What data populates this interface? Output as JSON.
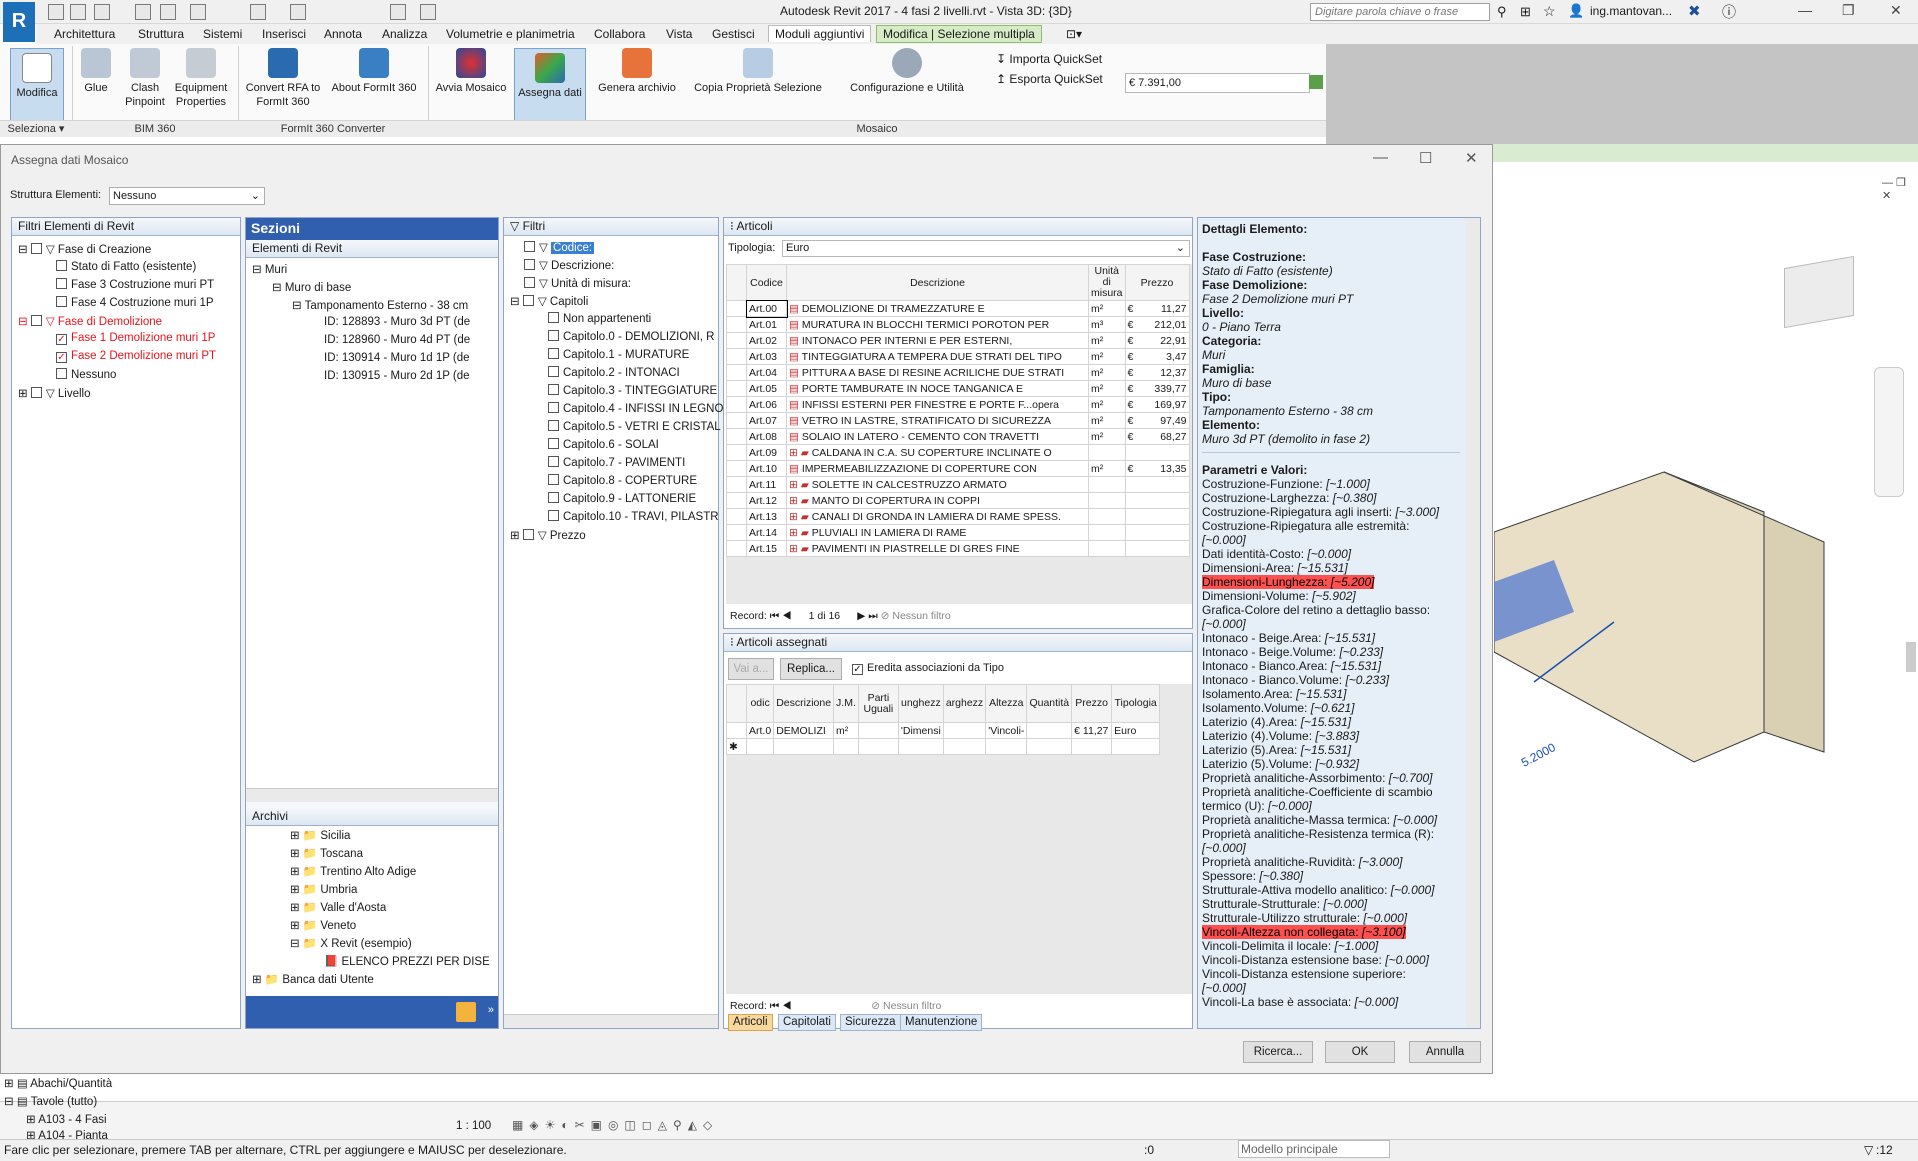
{
  "app": {
    "logo": "R",
    "title": "Autodesk Revit 2017 -    4 fasi 2 livelli.rvt - Vista 3D: {3D}",
    "search_placeholder": "Digitare parola chiave o frase",
    "user": "ing.mantovan..."
  },
  "tabs": [
    "Architettura",
    "Struttura",
    "Sistemi",
    "Inserisci",
    "Annota",
    "Analizza",
    "Volumetrie e planimetria",
    "Collabora",
    "Vista",
    "Gestisci",
    "Moduli aggiuntivi",
    "Modifica | Selezione multipla"
  ],
  "ribbon": {
    "buttons": [
      "Modifica",
      "Glue",
      "Clash Pinpoint",
      "Equipment Properties",
      "Convert RFA to FormIt 360",
      "About FormIt 360",
      "Avvia Mosaico",
      "Assegna dati",
      "Genera archivio",
      "Copia Proprietà Selezione",
      "Configurazione e Utilità",
      "Importa QuickSet",
      "Esporta QuickSet"
    ],
    "panels": [
      "Seleziona",
      "BIM 360",
      "FormIt 360 Converter",
      "Mosaico"
    ],
    "price": "€ 7.391,00"
  },
  "dialog": {
    "title": "Assegna dati Mosaico",
    "struttura_label": "Struttura Elementi:",
    "struttura_value": "Nessuno",
    "filtri_revit": {
      "header": "Filtri Elementi di Revit",
      "items": [
        "Fase di Creazione",
        "Stato di Fatto (esistente)",
        "Fase 3 Costruzione muri PT",
        "Fase 4 Costruzione muri 1P",
        "Fase di Demolizione",
        "Fase 1 Demolizione muri 1P",
        "Fase 2 Demolizione muri PT",
        "Nessuno",
        "Livello"
      ]
    },
    "sezioni": {
      "header": "Sezioni",
      "subheader": "Elementi di Revit",
      "items": [
        "Muri",
        "Muro di base",
        "Tamponamento Esterno - 38 cm",
        "ID: 128893 - Muro 3d PT (de",
        "ID: 128960 - Muro 4d PT (de",
        "ID: 130914 - Muro 1d 1P (de",
        "ID: 130915 - Muro 2d 1P (de"
      ]
    },
    "archivi": {
      "header": "Archivi",
      "items": [
        "Sicilia",
        "Toscana",
        "Trentino Alto Adige",
        "Umbria",
        "Valle d'Aosta",
        "Veneto",
        "X Revit (esempio)",
        "ELENCO PREZZI PER DISE",
        "Banca dati Utente"
      ]
    },
    "filtri": {
      "header": "Filtri",
      "items": [
        "Codice:",
        "Descrizione:",
        "Unità di misura:",
        "Capitoli",
        "Non appartenenti",
        "Capitolo.0 - DEMOLIZIONI, R",
        "Capitolo.1 - MURATURE",
        "Capitolo.2 - INTONACI",
        "Capitolo.3 - TINTEGGIATURE",
        "Capitolo.4 - INFISSI IN LEGNO",
        "Capitolo.5 - VETRI E CRISTAL",
        "Capitolo.6 - SOLAI",
        "Capitolo.7 - PAVIMENTI",
        "Capitolo.8 - COPERTURE",
        "Capitolo.9 - LATTONERIE",
        "Capitolo.10 - TRAVI, PILASTR",
        "Prezzo"
      ]
    },
    "articoli": {
      "header": "Articoli",
      "tipologia_label": "Tipologia:",
      "tipologia_value": "Euro",
      "columns": [
        "Codice",
        "Descrizione",
        "Unità di misura",
        "Prezzo"
      ],
      "rows": [
        {
          "code": "Art.00",
          "desc": "DEMOLIZIONE DI TRAMEZZATURE E",
          "unit": "m²",
          "cur": "€",
          "price": "11,27"
        },
        {
          "code": "Art.01",
          "desc": "MURATURA IN BLOCCHI TERMICI POROTON PER",
          "unit": "m³",
          "cur": "€",
          "price": "212,01"
        },
        {
          "code": "Art.02",
          "desc": "INTONACO PER INTERNI E PER ESTERNI,",
          "unit": "m²",
          "cur": "€",
          "price": "22,91"
        },
        {
          "code": "Art.03",
          "desc": "TINTEGGIATURA A TEMPERA DUE STRATI DEL TIPO",
          "unit": "m²",
          "cur": "€",
          "price": "3,47"
        },
        {
          "code": "Art.04",
          "desc": "PITTURA A BASE DI RESINE ACRILICHE DUE STRATI",
          "unit": "m²",
          "cur": "€",
          "price": "12,37"
        },
        {
          "code": "Art.05",
          "desc": "PORTE TAMBURATE IN NOCE TANGANICA E",
          "unit": "m²",
          "cur": "€",
          "price": "339,77"
        },
        {
          "code": "Art.06",
          "desc": "INFISSI ESTERNI PER FINESTRE E PORTE F...opera",
          "unit": "m²",
          "cur": "€",
          "price": "169,97"
        },
        {
          "code": "Art.07",
          "desc": "VETRO IN LASTRE, STRATIFICATO DI SICUREZZA",
          "unit": "m²",
          "cur": "€",
          "price": "97,49"
        },
        {
          "code": "Art.08",
          "desc": "SOLAIO IN LATERO - CEMENTO CON TRAVETTI",
          "unit": "m²",
          "cur": "€",
          "price": "68,27"
        },
        {
          "code": "Art.09",
          "desc": "CALDANA IN C.A. SU COPERTURE INCLINATE O",
          "unit": "",
          "cur": "",
          "price": ""
        },
        {
          "code": "Art.10",
          "desc": "IMPERMEABILIZZAZIONE DI COPERTURE CON",
          "unit": "m²",
          "cur": "€",
          "price": "13,35"
        },
        {
          "code": "Art.11",
          "desc": "SOLETTE IN CALCESTRUZZO ARMATO",
          "unit": "",
          "cur": "",
          "price": ""
        },
        {
          "code": "Art.12",
          "desc": "MANTO DI COPERTURA IN COPPI",
          "unit": "",
          "cur": "",
          "price": ""
        },
        {
          "code": "Art.13",
          "desc": "CANALI DI GRONDA IN LAMIERA DI RAME SPESS.",
          "unit": "",
          "cur": "",
          "price": ""
        },
        {
          "code": "Art.14",
          "desc": "PLUVIALI IN LAMIERA DI RAME",
          "unit": "",
          "cur": "",
          "price": ""
        },
        {
          "code": "Art.15",
          "desc": "PAVIMENTI IN PIASTRELLE DI GRES FINE",
          "unit": "",
          "cur": "",
          "price": ""
        }
      ],
      "record_label": "Record:",
      "record_value": "1 di 16",
      "no_filter": "Nessun filtro"
    },
    "assegnati": {
      "header": "Articoli assegnati",
      "vai": "Vai a...",
      "replica": "Replica...",
      "eredita": "Eredita associazioni da Tipo",
      "columns": [
        "odic",
        "Descrizione",
        "J.M.",
        "Parti Uguali",
        "unghezz",
        "arghezz",
        "Altezza",
        "Quantità",
        "Prezzo",
        "Tipologia"
      ],
      "row": [
        "Art.0",
        "DEMOLIZI",
        "m²",
        "",
        "'Dimensi",
        "",
        "'Vincoli-",
        "",
        "€   11,27",
        "Euro"
      ],
      "record_label": "Record:",
      "no_filter": "Nessun filtro"
    },
    "bottom_tabs": [
      "Articoli",
      "Capitolati",
      "Sicurezza",
      "Manutenzione"
    ],
    "details": {
      "header": "Dettagli Elemento:",
      "props": [
        {
          "k": "Fase Costruzione:",
          "v": "Stato di Fatto (esistente)"
        },
        {
          "k": "Fase Demolizione:",
          "v": "Fase 2 Demolizione muri PT"
        },
        {
          "k": "Livello:",
          "v": "0 - Piano Terra"
        },
        {
          "k": "Categoria:",
          "v": "Muri"
        },
        {
          "k": "Famiglia:",
          "v": "Muro di base"
        },
        {
          "k": "Tipo:",
          "v": "Tamponamento Esterno - 38 cm"
        },
        {
          "k": "Elemento:",
          "v": "Muro 3d PT (demolito in fase 2)"
        }
      ],
      "params_title": "Parametri e Valori:",
      "params": [
        {
          "k": "Costruzione-Funzione:",
          "v": "[~1.000]"
        },
        {
          "k": "Costruzione-Larghezza:",
          "v": "[~0.380]"
        },
        {
          "k": "Costruzione-Ripiegatura agli inserti:",
          "v": "[~3.000]"
        },
        {
          "k": "Costruzione-Ripiegatura alle estremità:",
          "v": ""
        },
        {
          "k": "",
          "v": "[~0.000]"
        },
        {
          "k": "Dati identità-Costo:",
          "v": "[~0.000]"
        },
        {
          "k": "Dimensioni-Area:",
          "v": "[~15.531]"
        },
        {
          "k": "Dimensioni-Lunghezza:",
          "v": "[~5.200]",
          "hl": true
        },
        {
          "k": "Dimensioni-Volume:",
          "v": "[~5.902]"
        },
        {
          "k": "Grafica-Colore del retino a dettaglio basso:",
          "v": ""
        },
        {
          "k": "",
          "v": "[~0.000]"
        },
        {
          "k": "Intonaco - Beige.Area:",
          "v": "[~15.531]"
        },
        {
          "k": "Intonaco - Beige.Volume:",
          "v": "[~0.233]"
        },
        {
          "k": "Intonaco - Bianco.Area:",
          "v": "[~15.531]"
        },
        {
          "k": "Intonaco - Bianco.Volume:",
          "v": "[~0.233]"
        },
        {
          "k": "Isolamento.Area:",
          "v": "[~15.531]"
        },
        {
          "k": "Isolamento.Volume:",
          "v": "[~0.621]"
        },
        {
          "k": "Laterizio (4).Area:",
          "v": "[~15.531]"
        },
        {
          "k": "Laterizio (4).Volume:",
          "v": "[~3.883]"
        },
        {
          "k": "Laterizio (5).Area:",
          "v": "[~15.531]"
        },
        {
          "k": "Laterizio (5).Volume:",
          "v": "[~0.932]"
        },
        {
          "k": "Proprietà analitiche-Assorbimento:",
          "v": "[~0.700]"
        },
        {
          "k": "Proprietà analitiche-Coefficiente di scambio",
          "v": ""
        },
        {
          "k": "termico (U):",
          "v": "[~0.000]"
        },
        {
          "k": "Proprietà analitiche-Massa termica:",
          "v": "[~0.000]"
        },
        {
          "k": "Proprietà analitiche-Resistenza termica (R):",
          "v": ""
        },
        {
          "k": "",
          "v": "[~0.000]"
        },
        {
          "k": "Proprietà analitiche-Ruvidità:",
          "v": "[~3.000]"
        },
        {
          "k": "Spessore:",
          "v": "[~0.380]"
        },
        {
          "k": "Strutturale-Attiva modello analitico:",
          "v": "[~0.000]"
        },
        {
          "k": "Strutturale-Strutturale:",
          "v": "[~0.000]"
        },
        {
          "k": "Strutturale-Utilizzo strutturale:",
          "v": "[~0.000]"
        },
        {
          "k": "Vincoli-Altezza non collegata:",
          "v": "[~3.100]",
          "hl": true
        },
        {
          "k": "Vincoli-Delimita il locale:",
          "v": "[~1.000]"
        },
        {
          "k": "Vincoli-Distanza estensione base:",
          "v": "[~0.000]"
        },
        {
          "k": "Vincoli-Distanza estensione superiore:",
          "v": ""
        },
        {
          "k": "",
          "v": "[~0.000]"
        },
        {
          "k": "Vincoli-La base è associata:",
          "v": "[~0.000]"
        }
      ]
    },
    "buttons": {
      "ricerca": "Ricerca...",
      "ok": "OK",
      "annulla": "Annulla"
    }
  },
  "project_browser": [
    "Abachi/Quantità",
    "Tavole (tutto)",
    "A103 - 4 Fasi",
    "A104 - Pianta"
  ],
  "view_scale": "1 : 100",
  "dimension_label": "5.2000",
  "status": {
    "text": "Fare clic per selezionare, premere TAB per alternare, CTRL per aggiungere e MAIUSC per deselezionare.",
    "zero": ":0",
    "model": "Modello principale",
    "filter_count": ":12"
  },
  "colors": {
    "accent": "#1d6fb8",
    "sections_header": "#2f5fae",
    "highlight": "#ff5050"
  }
}
